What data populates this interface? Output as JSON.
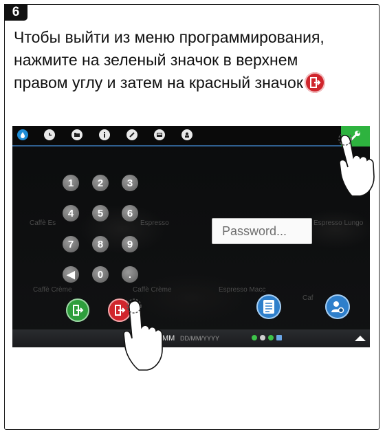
{
  "step": {
    "number": "6"
  },
  "instruction": {
    "line1": "Чтобы выйти из меню программирования,",
    "line2": "нажмите на зеленый значок в верхнем",
    "line3": "правом углу и затем на красный значок"
  },
  "screen": {
    "password_placeholder": "Password...",
    "keypad": {
      "keys": [
        "1",
        "2",
        "3",
        "4",
        "5",
        "6",
        "7",
        "8",
        "9",
        "◀",
        "0",
        "."
      ]
    },
    "background_labels": [
      "Caffè Es",
      "Espresso",
      "Caffè Crème",
      "Caffè Crème",
      "Espresso Macc",
      "Espresso Lungo",
      "Caf"
    ],
    "statusbar": {
      "time_format": "MM",
      "date_format": "DD/MM/YYYY"
    },
    "top_icons": [
      "water-drop-icon",
      "clock-icon",
      "folder-icon",
      "info-icon",
      "pencil-icon",
      "screen-icon",
      "user-badge-icon"
    ],
    "colors": {
      "green_action": "#2eb33f",
      "red_exit": "#d0252c",
      "blue_action": "#2e7fcb",
      "topbar_line": "#2f5f8f"
    }
  }
}
